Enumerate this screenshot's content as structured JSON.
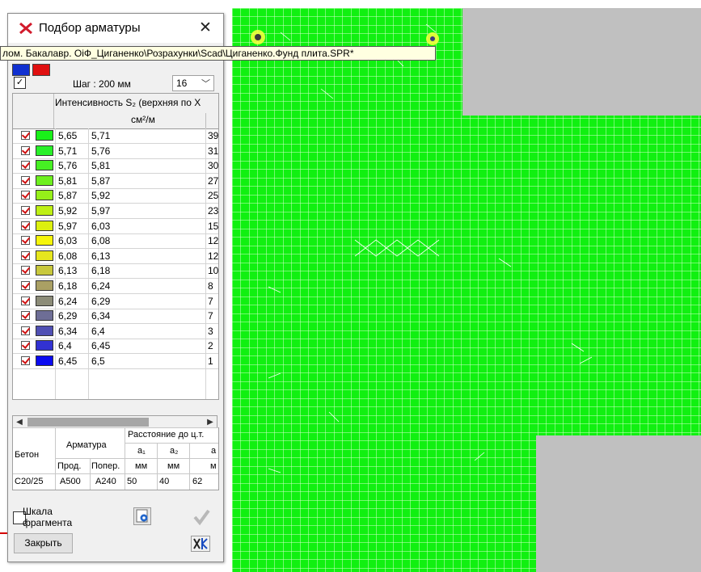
{
  "dialog": {
    "title": "Подбор арматуры",
    "close_glyph": "✕",
    "step_label": "Шаг : 200 мм",
    "step_checked": "✓",
    "diameter_value": "16",
    "table_header_1": "Интенсивность S₂ (верхняя по X",
    "table_header_units": "см²/м",
    "rows": [
      {
        "from": "5,65",
        "to": "5,71",
        "count": "39",
        "color": "#19f019"
      },
      {
        "from": "5,71",
        "to": "5,76",
        "count": "31",
        "color": "#28f028"
      },
      {
        "from": "5,76",
        "to": "5,81",
        "count": "30",
        "color": "#46f023"
      },
      {
        "from": "5,81",
        "to": "5,87",
        "count": "27",
        "color": "#6ef01e"
      },
      {
        "from": "5,87",
        "to": "5,92",
        "count": "25",
        "color": "#96f019"
      },
      {
        "from": "5,92",
        "to": "5,97",
        "count": "23",
        "color": "#bef014"
      },
      {
        "from": "5,97",
        "to": "6,03",
        "count": "15",
        "color": "#dcf00f"
      },
      {
        "from": "6,03",
        "to": "6,08",
        "count": "12",
        "color": "#f5f50a"
      },
      {
        "from": "6,08",
        "to": "6,13",
        "count": "12",
        "color": "#e6e61e"
      },
      {
        "from": "6,13",
        "to": "6,18",
        "count": "10",
        "color": "#c8c83c"
      },
      {
        "from": "6,18",
        "to": "6,24",
        "count": "8",
        "color": "#aaa064"
      },
      {
        "from": "6,24",
        "to": "6,29",
        "count": "7",
        "color": "#8c8c78"
      },
      {
        "from": "6,29",
        "to": "6,34",
        "count": "7",
        "color": "#6e6e96"
      },
      {
        "from": "6,34",
        "to": "6,4",
        "count": "3",
        "color": "#5050b4"
      },
      {
        "from": "6,4",
        "to": "6,45",
        "count": "2",
        "color": "#3232d2"
      },
      {
        "from": "6,45",
        "to": "6,5",
        "count": "1",
        "color": "#0a0af0"
      }
    ],
    "bottom_table": {
      "beton_label": "Бетон",
      "armatura_label": "Арматура",
      "distance_label": "Расстояние до ц.т.",
      "prod_label": "Прод.",
      "poper_label": "Попер.",
      "a1_label": "a₁",
      "a2_label": "a₂",
      "a3_label": "a",
      "mm1": "мм",
      "mm2": "мм",
      "mm3": "м",
      "beton_value": "С20/25",
      "prod_value": "А500",
      "poper_value": "А240",
      "a1_value": "50",
      "a2_value": "40",
      "a3_value": "62"
    },
    "scale_label": "Шкала фрагмента",
    "close_button_label": "Закрыть"
  },
  "tooltip_text": "лом. Бакалавр. ОіФ_Циганенко\\Розрахунки\\Scad\\Циганенко.Фунд плита.SPR*",
  "colors": {
    "mesh_fill": "#11f011",
    "mesh_line": "#ffffff",
    "background": "#c0c0c0"
  }
}
